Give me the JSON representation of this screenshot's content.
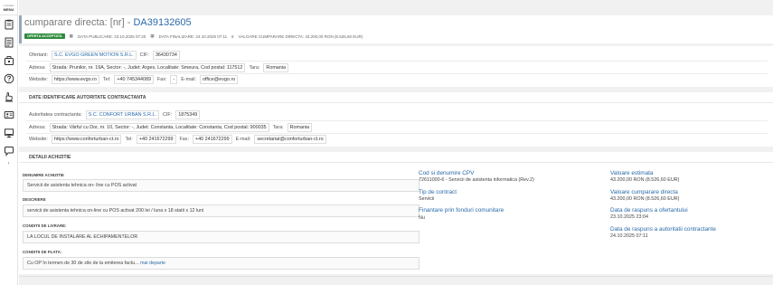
{
  "sidebar": {
    "menu_small": "e-licitatie",
    "menu_label": "MENU",
    "icons": [
      "clipboard-icon",
      "document-list-icon",
      "briefcase-icon",
      "help-icon",
      "hand-gavel-icon",
      "id-card-icon",
      "monitor-icon",
      "chat-icon"
    ],
    "expand": "›"
  },
  "header": {
    "title_prefix": "cumparare directa: [nr] - ",
    "title_id": "DA39132605",
    "badge": "OFERTA ACCEPTATA",
    "date_published": "DATA PUBLICARE: 23.10.2025 07:20",
    "date_finalized": "DATA FINALIZARE: 24.10.2025 07:11",
    "value": "VALOARE CUMPARARE DIRECTA: 43.200,00  RON (8.526,60  EUR)"
  },
  "offerer": {
    "ofertant_label": "Ofertant:",
    "ofertant_value": "S.C. EVGO GREEN MOTION S.R.L.",
    "cif_label": "CIF:",
    "cif_value": "36430734",
    "adresa_label": "Adresa:",
    "adresa_value": "Strada: Prunilor, nr. 19A, Sector: -, Judet: Arges, Localitate: Smeura, Cod postal: 117512",
    "tara_label": "Tara:",
    "tara_value": "Romania",
    "website_label": "Website:",
    "website_value": "https://www.evgo.ro",
    "tel_label": "Tel:",
    "tel_value": "+40 745344089",
    "fax_label": "Fax:",
    "fax_value": "-",
    "email_label": "E-mail:",
    "email_value": "office@evgo.ro"
  },
  "authority": {
    "header": "DATE IDENTIFICARE AUTORITATE CONTRACTANTA",
    "autoritate_label": "Autoritatea contractanta:",
    "autoritate_value": "S.C. CONFORT URBAN S.R.L.",
    "cif_label": "CIF:",
    "cif_value": "1875349",
    "adresa_label": "Adresa:",
    "adresa_value": "Strada: Vârful cu Dor, nr. 10, Sector: -, Judet: Constanta, Localitate: Constanta, Cod postal: 900035",
    "tara_label": "Tara:",
    "tara_value": "Romania",
    "website_label": "Website:",
    "website_value": "https://www.conforturban-ct.ro",
    "tel_label": "Tel:",
    "tel_value": "+40 241672299",
    "fax_label": "Fax:",
    "fax_value": "+40 241672299",
    "email_label": "E-mail:",
    "email_value": "secretariat@conforturban-ct.ro"
  },
  "details": {
    "header": "DETALII ACHIZITIE",
    "denumire_label": "DENUMIRE ACHIZITIE",
    "denumire_value": "Servicii de asistenta tehnica on- line cu POS activat",
    "descriere_label": "DESCRIERE",
    "descriere_value": "servicii de asistenta tehnica on-line cu POS activat 200 lei / luna x 18 statii x 12 luni",
    "livrare_label": "CONDITII DE LIVRARE:",
    "livrare_value": "LA LOCUL DE INSTALARE AL ECHIPAMENTELOR",
    "plata_label": "CONDITII DE PLATA:",
    "plata_value": "Cu OP în termen de 30 de zile de la emiterea factu...",
    "plata_more": "mai departe",
    "cpv_title": "Cod si denumire CPV",
    "cpv_value": "72611000-6 - Servicii de asistenta informatica (Rev.2)",
    "tip_title": "Tip de contract",
    "tip_value": "Servicii",
    "fonduri_title": "Finantare prin fonduri comunitare",
    "fonduri_value": "Nu",
    "estimata_title": "Valoare estimata",
    "estimata_value": "43.200,00  RON (8.526,60  EUR)",
    "cumparare_title": "Valoare cumparare directa",
    "cumparare_value": "43.200,00  RON (8.526,60  EUR)",
    "raspuns_ofertant_title": "Data de raspuns a ofertantului",
    "raspuns_ofertant_value": "23.10.2025 23:04",
    "raspuns_autoritate_title": "Data de raspuns a autoritatii contractante",
    "raspuns_autoritate_value": "24.10.2025 07:11"
  }
}
